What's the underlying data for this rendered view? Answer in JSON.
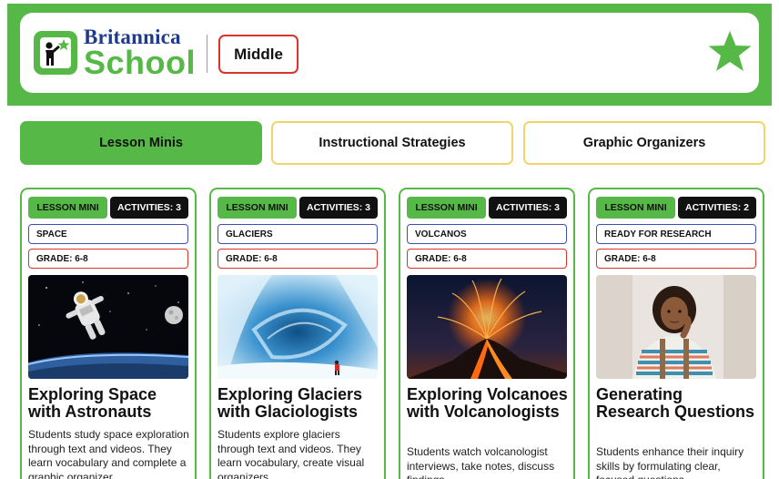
{
  "header": {
    "brand_top": "Britannica",
    "brand_bottom": "School",
    "level": "Middle",
    "colors": {
      "green": "#56b947",
      "navy": "#1f3a8a",
      "red": "#d9342b",
      "yellow": "#f0d56a"
    }
  },
  "tabs": [
    {
      "label": "Lesson Minis",
      "active": true
    },
    {
      "label": "Instructional Strategies",
      "active": false
    },
    {
      "label": "Graphic Organizers",
      "active": false
    }
  ],
  "cards": [
    {
      "type": "LESSON MINI",
      "activities": "ACTIVITIES: 3",
      "topic": "SPACE",
      "grade": "GRADE: 6-8",
      "image": "astronaut-in-space",
      "title": "Exploring Space with Astronauts",
      "desc": "Students study space exploration through text and videos. They learn vocabulary and complete a graphic organizer."
    },
    {
      "type": "LESSON MINI",
      "activities": "ACTIVITIES: 3",
      "topic": "GLACIERS",
      "grade": "GRADE: 6-8",
      "image": "glacier-ice-cave",
      "title": "Exploring Glaciers with Glaciologists",
      "desc": "Students explore glaciers through text and videos. They learn vocabulary, create visual organizers."
    },
    {
      "type": "LESSON MINI",
      "activities": "ACTIVITIES: 3",
      "topic": "VOLCANOS",
      "grade": "GRADE: 6-8",
      "image": "erupting-volcano",
      "title": "Exploring Volcanoes with Volcanologists",
      "desc": "Students watch volcanologist interviews, take notes, discuss findings."
    },
    {
      "type": "LESSON MINI",
      "activities": "ACTIVITIES: 2",
      "topic": "READY FOR RESEARCH",
      "grade": "GRADE: 6-8",
      "image": "thinking-student",
      "title": "Generating Research Questions",
      "desc": "Students enhance their inquiry skills by formulating clear, focused questions."
    }
  ]
}
